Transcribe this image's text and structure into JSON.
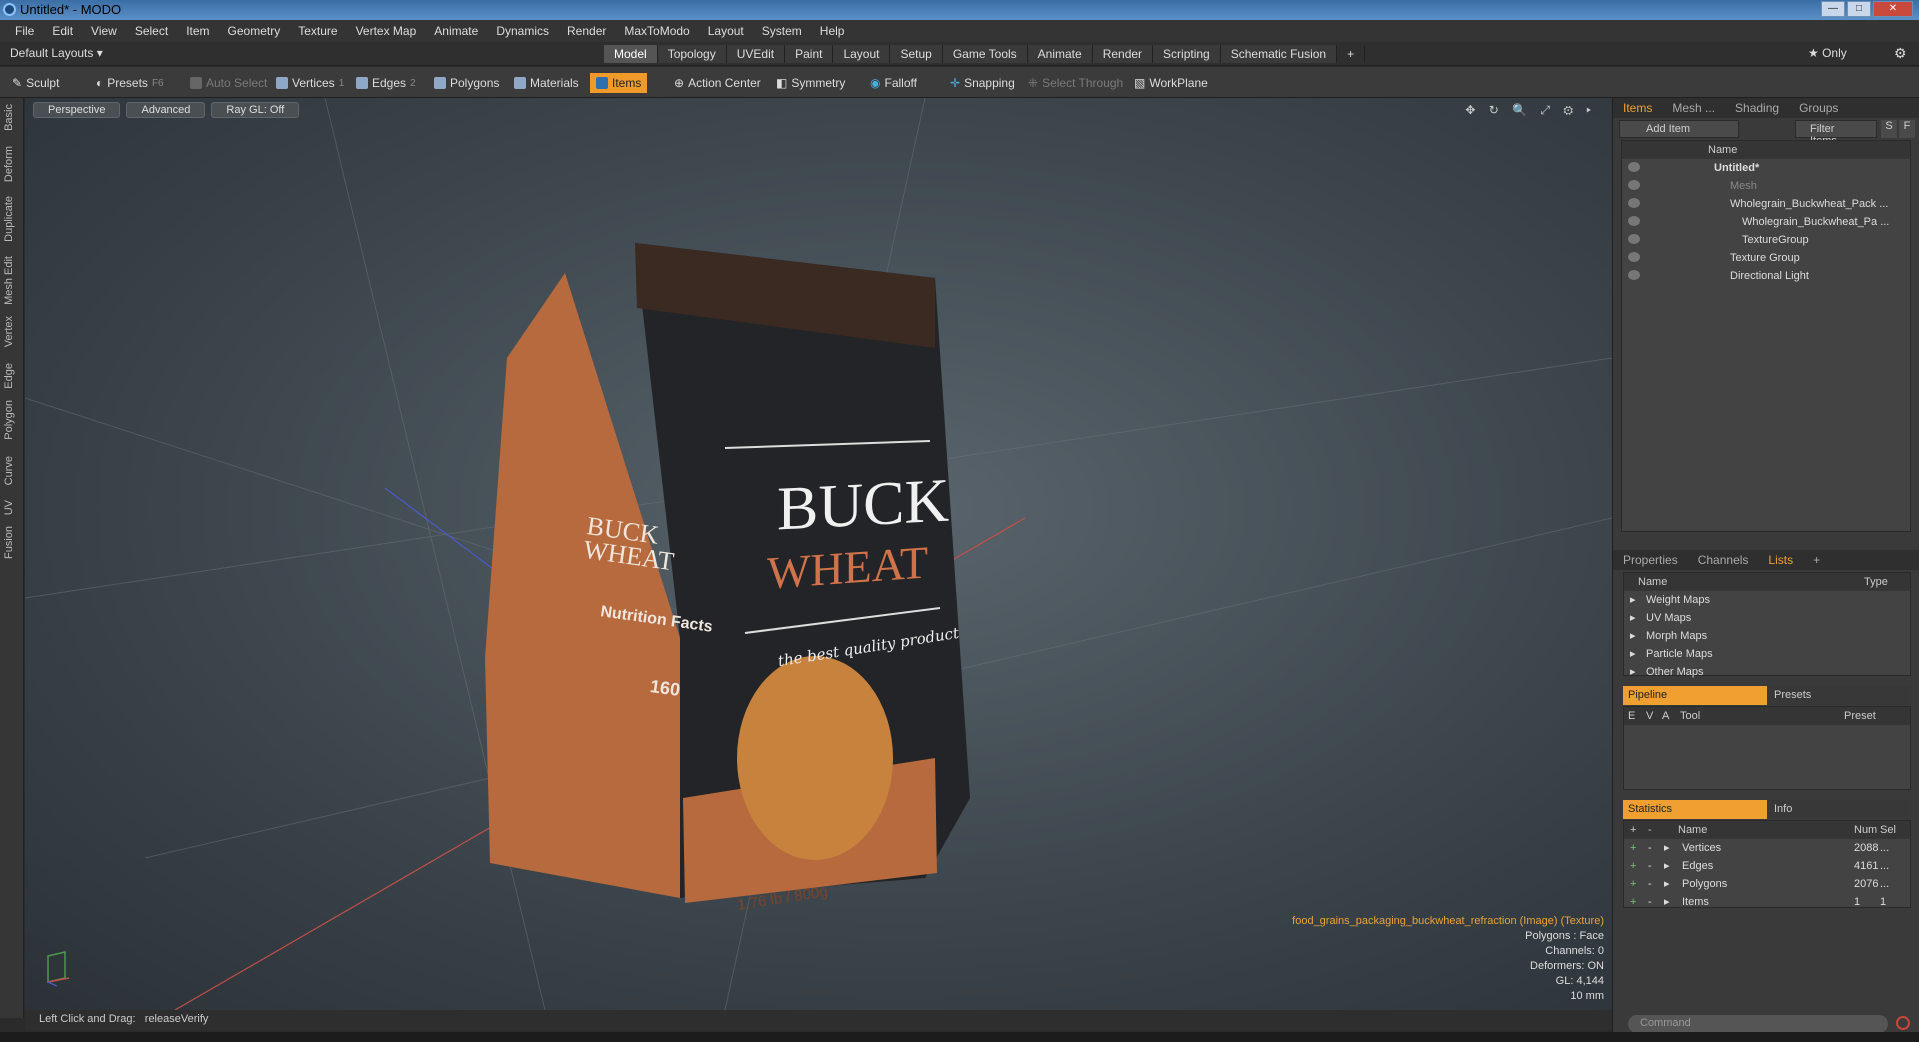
{
  "window": {
    "title": "Untitled* - MODO",
    "minimize": "—",
    "maximize": "□",
    "close": "✕"
  },
  "menu": [
    "File",
    "Edit",
    "View",
    "Select",
    "Item",
    "Geometry",
    "Texture",
    "Vertex Map",
    "Animate",
    "Dynamics",
    "Render",
    "MaxToModo",
    "Layout",
    "System",
    "Help"
  ],
  "layoutbar": {
    "layout": "Default Layouts ▾",
    "tabs": [
      "Model",
      "Topology",
      "UVEdit",
      "Paint",
      "Layout",
      "Setup",
      "Game Tools",
      "Animate",
      "Render",
      "Scripting",
      "Schematic Fusion"
    ],
    "active_tab": "Model",
    "add": "+",
    "only": "★ Only"
  },
  "toolbar": {
    "sculpt": "Sculpt",
    "presets": "Presets",
    "presets_key": "F6",
    "auto_select": "Auto Select",
    "vertices": "Vertices",
    "vertices_n": "1",
    "edges": "Edges",
    "edges_n": "2",
    "polygons": "Polygons",
    "materials": "Materials",
    "items": "Items",
    "action_center": "Action Center",
    "symmetry": "Symmetry",
    "falloff": "Falloff",
    "snapping": "Snapping",
    "select_through": "Select Through",
    "workplane": "WorkPlane"
  },
  "lefttabs": [
    "Basic",
    "Deform",
    "Duplicate",
    "Mesh Edit",
    "Vertex",
    "Edge",
    "Polygon",
    "Curve",
    "UV",
    "Fusion"
  ],
  "viewport": {
    "view": "Perspective",
    "mode": "Advanced",
    "raygl": "Ray GL: Off",
    "icons": "✥ ↻ 🔍 ⤢ ⚙ ▸",
    "product": {
      "brand_top": "BUCK",
      "brand_bottom": "WHEAT",
      "tagline": "the best quality product",
      "weight": "1.76 lb / 800g",
      "side_brand": "BUCK WHEAT",
      "nutrition": "Nutrition Facts",
      "calories": "160"
    },
    "info": {
      "texture": "food_grains_packaging_buckwheat_refraction (Image) (Texture)",
      "polygons": "Polygons : Face",
      "channels": "Channels: 0",
      "deformers": "Deformers: ON",
      "gl": "GL: 4,144",
      "scale": "10 mm"
    }
  },
  "statusbar": {
    "hint": "Left Click and Drag:",
    "action": "releaseVerify"
  },
  "items_panel": {
    "tabs": [
      "Items",
      "Mesh ...",
      "Shading",
      "Groups"
    ],
    "add_item": "Add Item",
    "filter": "Filter Items",
    "s": "S",
    "f": "F",
    "col_name": "Name",
    "tree": [
      {
        "label": "Untitled*",
        "indent": 0,
        "bold": true
      },
      {
        "label": "Mesh",
        "indent": 1,
        "dim": true
      },
      {
        "label": "Wholegrain_Buckwheat_Pack ...",
        "indent": 1
      },
      {
        "label": "Wholegrain_Buckwheat_Pa ...",
        "indent": 2
      },
      {
        "label": "TextureGroup",
        "indent": 2
      },
      {
        "label": "Texture Group",
        "indent": 1
      },
      {
        "label": "Directional Light",
        "indent": 1
      }
    ]
  },
  "lists_panel": {
    "tabs": [
      "Properties",
      "Channels",
      "Lists",
      "+"
    ],
    "col_name": "Name",
    "col_type": "Type",
    "rows": [
      "Weight Maps",
      "UV Maps",
      "Morph Maps",
      "Particle Maps",
      "Other Maps"
    ]
  },
  "pipeline_panel": {
    "tab_on": "Pipeline",
    "tab_off": "Presets",
    "cols": [
      "E",
      "V",
      "A",
      "Tool",
      "Preset"
    ]
  },
  "stats_panel": {
    "tab_on": "Statistics",
    "tab_off": "Info",
    "cols": [
      "+",
      "-",
      "Name",
      "Num",
      "Sel"
    ],
    "rows": [
      {
        "name": "Vertices",
        "num": "2088",
        "sel": "..."
      },
      {
        "name": "Edges",
        "num": "4161",
        "sel": "..."
      },
      {
        "name": "Polygons",
        "num": "2076",
        "sel": "..."
      },
      {
        "name": "Items",
        "num": "1",
        "sel": "1"
      }
    ]
  },
  "command": {
    "placeholder": "Command"
  }
}
